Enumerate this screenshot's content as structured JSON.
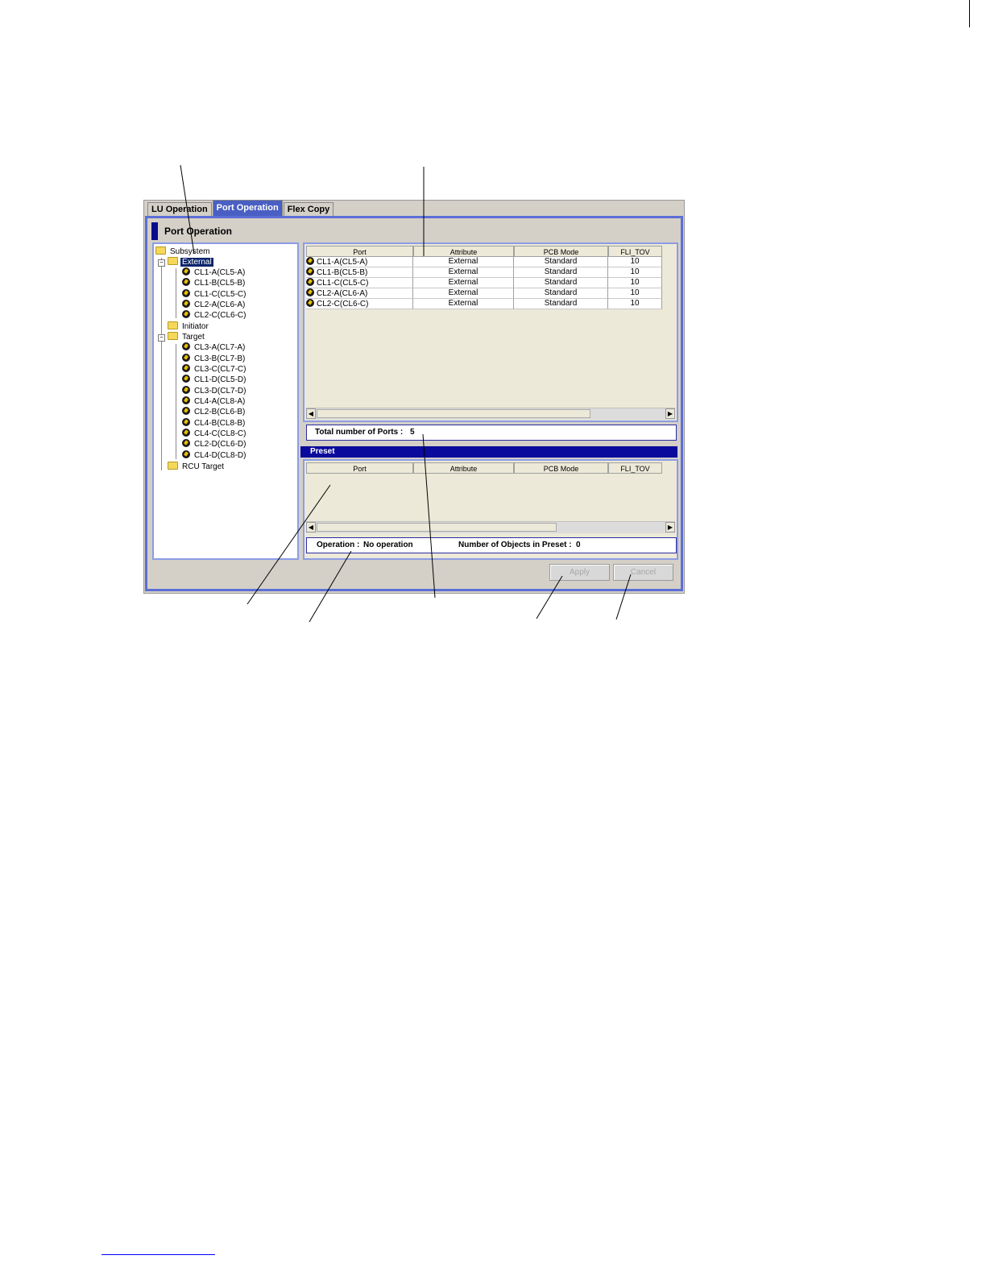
{
  "tabs": [
    {
      "label": "LU Operation",
      "active": false
    },
    {
      "label": "Port Operation",
      "active": true
    },
    {
      "label": "Flex Copy",
      "active": false
    }
  ],
  "panel_title": "Port Operation",
  "tree": {
    "root": "Subsystem",
    "external": {
      "label": "External",
      "ports": [
        "CL1-A(CL5-A)",
        "CL1-B(CL5-B)",
        "CL1-C(CL5-C)",
        "CL2-A(CL6-A)",
        "CL2-C(CL6-C)"
      ]
    },
    "initiator": "Initiator",
    "target": {
      "label": "Target",
      "ports": [
        "CL3-A(CL7-A)",
        "CL3-B(CL7-B)",
        "CL3-C(CL7-C)",
        "CL1-D(CL5-D)",
        "CL3-D(CL7-D)",
        "CL4-A(CL8-A)",
        "CL2-B(CL6-B)",
        "CL4-B(CL8-B)",
        "CL4-C(CL8-C)",
        "CL2-D(CL6-D)",
        "CL4-D(CL8-D)"
      ]
    },
    "rcu_target": "RCU Target"
  },
  "port_table": {
    "columns": [
      "Port",
      "Attribute",
      "PCB Mode",
      "FLI_TOV"
    ],
    "rows": [
      [
        "CL1-A(CL5-A)",
        "External",
        "Standard",
        "10"
      ],
      [
        "CL1-B(CL5-B)",
        "External",
        "Standard",
        "10"
      ],
      [
        "CL1-C(CL5-C)",
        "External",
        "Standard",
        "10"
      ],
      [
        "CL2-A(CL6-A)",
        "External",
        "Standard",
        "10"
      ],
      [
        "CL2-C(CL6-C)",
        "External",
        "Standard",
        "10"
      ]
    ]
  },
  "total_ports": {
    "label": "Total number of Ports :",
    "value": "5"
  },
  "preset": {
    "title": "Preset",
    "columns": [
      "Port",
      "Attribute",
      "PCB Mode",
      "FLI_TOV"
    ]
  },
  "operation": {
    "label": "Operation :",
    "value": "No operation"
  },
  "preset_count": {
    "label": "Number of Objects in Preset :",
    "value": "0"
  },
  "buttons": {
    "apply": "Apply",
    "cancel": "Cancel"
  }
}
